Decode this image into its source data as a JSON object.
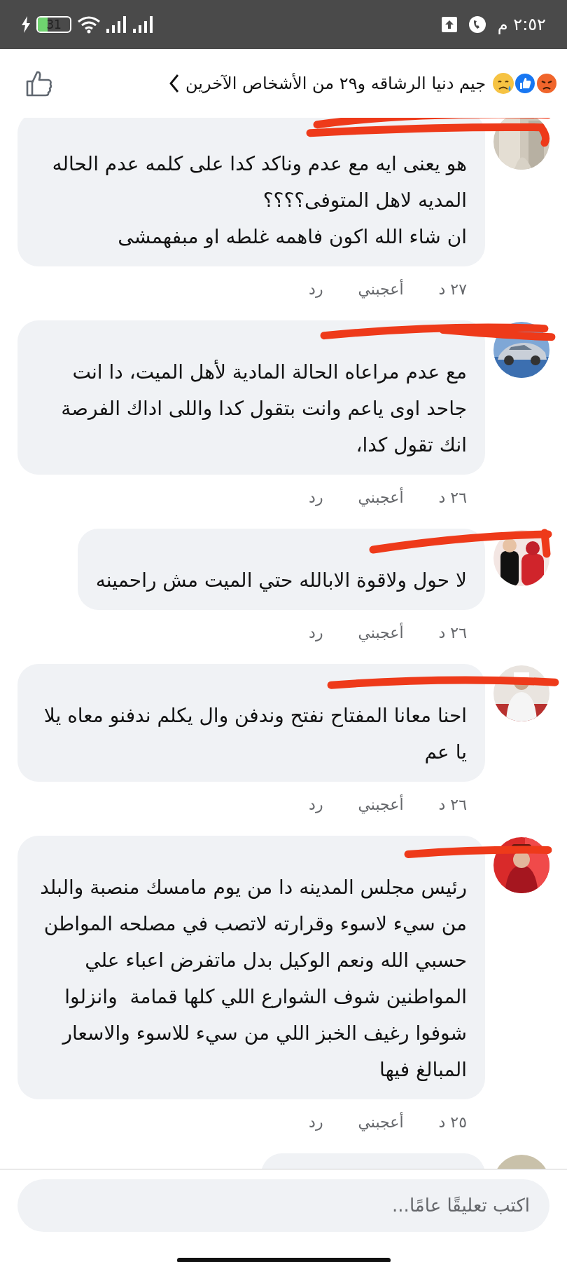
{
  "status_bar": {
    "time": "٢:٥٢ م",
    "battery": "31"
  },
  "header": {
    "title": "جيم دنيا الرشاقه و٢٩ من الأشخاص الآخرين"
  },
  "comments": [
    {
      "text": "هو يعنى ايه مع عدم وناكد كدا على كلمه عدم الحاله المديه لاهل المتوفى؟؟؟؟\nان شاء الله اكون فاهمه غلطه او مبفهمشى",
      "time": "٢٧ د",
      "like": "أعجبني",
      "reply": "رد"
    },
    {
      "text": "مع عدم مراعاه الحالة المادية لأهل الميت، دا انت جاحد اوى ياعم وانت بتقول كدا واللى اداك الفرصة انك تقول كدا،",
      "time": "٢٦ د",
      "like": "أعجبني",
      "reply": "رد"
    },
    {
      "text": "لا حول ولاقوة الابالله حتي الميت مش راحمينه",
      "time": "٢٦ د",
      "like": "أعجبني",
      "reply": "رد"
    },
    {
      "text": "احنا معانا المفتاح نفتح وندفن وال يكلم ندفنو معاه يلا يا عم",
      "time": "٢٦ د",
      "like": "أعجبني",
      "reply": "رد"
    },
    {
      "text": "رئيس مجلس المدينه دا من يوم مامسك منصبة والبلد من سيء لاسوء وقرارته لاتصب في مصلحه المواطن حسبي الله ونعم الوكيل بدل ماتفرض اعباء علي المواطنين شوف الشوارع اللي كلها قمامة  وانزلوا شوفوا رغيف الخبز اللي من سيء للاسوء والاسعار المبالغ فيها",
      "time": "٢٥ د",
      "like": "أعجبني",
      "reply": "رد"
    }
  ],
  "composer": {
    "placeholder": "اكتب تعليقًا عامًا..."
  }
}
